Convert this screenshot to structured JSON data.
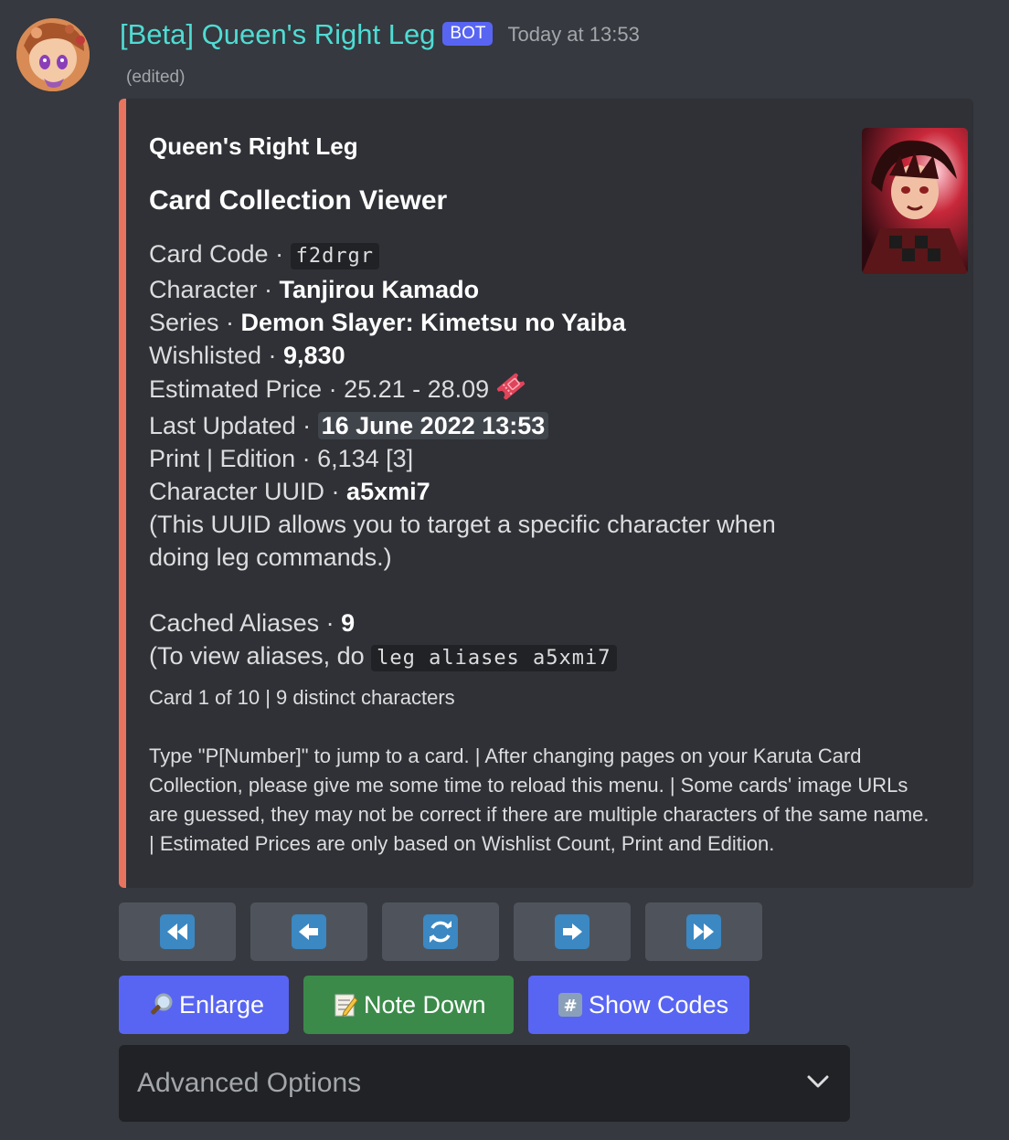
{
  "message": {
    "username": "[Beta] Queen's Right Leg",
    "bot_tag": "BOT",
    "timestamp": "Today at 13:53",
    "edited": "(edited)"
  },
  "colors": {
    "username": "#4fdcd4",
    "embed_accent": "#e8735f",
    "bot_tag": "#5865f2",
    "blurple_button": "#5865f2",
    "green_button": "#3b8a4a"
  },
  "embed": {
    "author": "Queen's Right Leg",
    "title": "Card Collection Viewer",
    "fields": {
      "card_code_label": "Card Code · ",
      "card_code_value": "f2drgr",
      "character_label": "Character · ",
      "character_value": "Tanjirou Kamado",
      "series_label": "Series · ",
      "series_value": "Demon Slayer: Kimetsu no Yaiba",
      "wishlisted_label": "Wishlisted · ",
      "wishlisted_value": "9,830",
      "price_label": "Estimated Price · ",
      "price_value": "25.21 - 28.09",
      "price_icon": "ticket-icon",
      "updated_label": "Last Updated · ",
      "updated_value": "16 June 2022 13:53",
      "print_label": "Print | Edition · ",
      "print_value": "6,134 [3]",
      "uuid_label": "Character UUID · ",
      "uuid_value": "a5xmi7",
      "uuid_note_1": "(This UUID allows you to target a specific character when",
      "uuid_note_2": "doing leg commands.)",
      "aliases_label": "Cached Aliases · ",
      "aliases_value": "9",
      "aliases_hint": "(To view aliases, do ",
      "aliases_command": "leg aliases a5xmi7"
    },
    "card_counter": "Card 1 of 10 | 9 distinct characters",
    "footer_note": "Type \"P[Number]\" to jump to a card. | After changing pages on your Karuta Card Collection, please give me some time to reload this menu. | Some cards' image URLs are guessed, they may not be correct if there are multiple characters of the same name. | Estimated Prices are only based on Wishlist Count, Print and Edition."
  },
  "nav_buttons": [
    {
      "icon": "rewind-icon"
    },
    {
      "icon": "arrow-left-icon"
    },
    {
      "icon": "refresh-icon"
    },
    {
      "icon": "arrow-right-icon"
    },
    {
      "icon": "fast-forward-icon"
    }
  ],
  "actions": {
    "enlarge_label": "Enlarge",
    "enlarge_icon": "magnifier-icon",
    "note_label": "Note Down",
    "note_icon": "memo-icon",
    "codes_label": "Show Codes",
    "codes_icon": "hash-keycap-icon"
  },
  "select": {
    "placeholder": "Advanced Options"
  }
}
